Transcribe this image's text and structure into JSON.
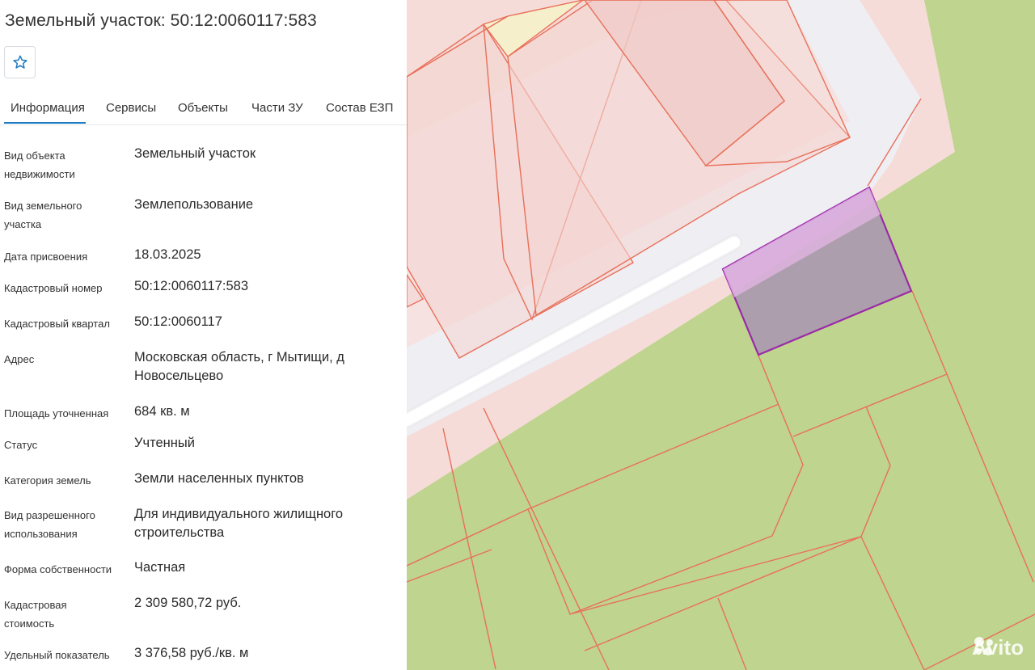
{
  "title": "Земельный участок: 50:12:0060117:583",
  "tabs": [
    "Информация",
    "Сервисы",
    "Объекты",
    "Части ЗУ",
    "Состав ЕЗП"
  ],
  "rows": [
    {
      "label": "Вид объекта недвижимости",
      "value": "Земельный участок"
    },
    {
      "label": "Вид земельного участка",
      "value": "Землепользование"
    },
    {
      "label": "Дата присвоения",
      "value": "18.03.2025"
    },
    {
      "label": "Кадастровый номер",
      "value": "50:12:0060117:583"
    },
    {
      "label": "Кадастровый квартал",
      "value": "50:12:0060117"
    },
    {
      "label": "Адрес",
      "value": "Московская область, г Мытищи, д Новосельцево"
    },
    {
      "label": "Площадь уточненная",
      "value": "684 кв. м"
    },
    {
      "label": "Статус",
      "value": "Учтенный"
    },
    {
      "label": "Категория земель",
      "value": "Земли населенных пунктов"
    },
    {
      "label": "Вид разрешенного использования",
      "value": "Для индивидуального жилищного строительства"
    },
    {
      "label": "Форма собственности",
      "value": "Частная"
    },
    {
      "label": "Кадастровая стоимость",
      "value": "2 309 580,72 руб."
    },
    {
      "label": "Удельный показатель",
      "value": "3 376,58 руб./кв. м"
    }
  ],
  "watermark": "Avito",
  "icons": {
    "favorite": "star-outline-icon",
    "watermark": "avito-logo-icon"
  },
  "colors": {
    "accent": "#1f7bc1",
    "map_green": "#bfd48e",
    "parcel_fill": "#f2dede",
    "parcel_line": "#e8705a",
    "selected_outline": "#9b2aa8"
  }
}
